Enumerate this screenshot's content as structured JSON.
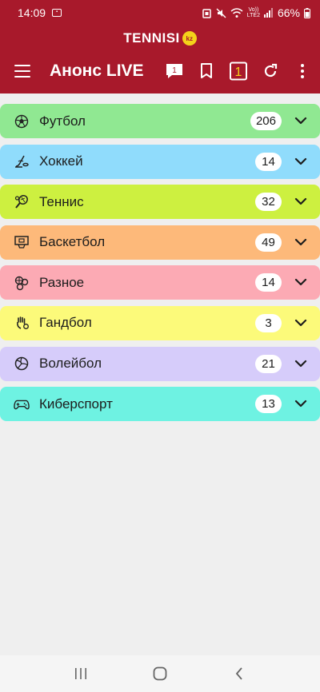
{
  "status_bar": {
    "time": "14:09",
    "battery": "66%",
    "network": "LTE2",
    "network_top": "Vo))"
  },
  "brand": {
    "name": "TENNISI",
    "badge": "kz"
  },
  "app_bar": {
    "title": "Анонс LIVE",
    "chat_badge": "1",
    "coupon_count": "1"
  },
  "sports": [
    {
      "name": "Футбол",
      "count": "206",
      "color": "#90e892",
      "icon": "soccer-ball-icon"
    },
    {
      "name": "Хоккей",
      "count": "14",
      "color": "#90dcfc",
      "icon": "hockey-icon"
    },
    {
      "name": "Теннис",
      "count": "32",
      "color": "#cdf040",
      "icon": "tennis-icon"
    },
    {
      "name": "Баскетбол",
      "count": "49",
      "color": "#fdb97a",
      "icon": "basketball-hoop-icon"
    },
    {
      "name": "Разное",
      "count": "14",
      "color": "#fcaab4",
      "icon": "misc-balls-icon"
    },
    {
      "name": "Гандбол",
      "count": "3",
      "color": "#fcfa7a",
      "icon": "handball-icon"
    },
    {
      "name": "Волейбол",
      "count": "21",
      "color": "#d6ccfa",
      "icon": "volleyball-icon"
    },
    {
      "name": "Киберспорт",
      "count": "13",
      "color": "#6ef2e2",
      "icon": "gamepad-icon"
    }
  ],
  "colors": {
    "header": "#a8192b",
    "background": "#efefef",
    "badge_yellow": "#f4d21a"
  }
}
